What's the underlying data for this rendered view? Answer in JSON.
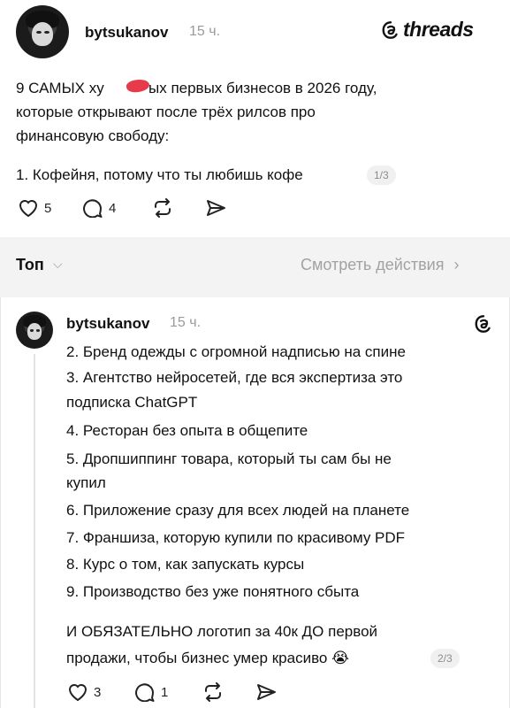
{
  "post1": {
    "username": "bytsukanov",
    "time": "15 ч.",
    "logo": "threads",
    "lines": [
      "9 САМЫХ ху",
      "ых первых бизнесов в 2026 году,",
      "которые открывают после трёх рилсов про",
      "финансовую свободу:"
    ],
    "item": "1. Кофейня, потому что ты любишь кофе",
    "page_badge": "1/3",
    "likes": "5",
    "replies": "4"
  },
  "toolbar": {
    "sort_label": "Топ",
    "view_activity": "Смотреть действия"
  },
  "post2": {
    "username": "bytsukanov",
    "time": "15 ч.",
    "lines": [
      "2. Бренд одежды с огромной надписью на спине",
      "3. Агентство нейросетей, где вся экспертиза это",
      "подписка ChatGPT",
      "4. Ресторан без опыта в общепите",
      "5. Дропшиппинг товара, который ты сам бы не",
      "купил",
      "6. Приложение сразу для всех людей на планете",
      "7. Франшиза, которую купили по красивому PDF",
      "8. Курс о том, как запускать курсы",
      "9. Производство без уже понятного сбыта"
    ],
    "closing_lines": [
      "И ОБЯЗАТЕЛЬНО логотип за 40к ДО первой",
      "продажи, чтобы бизнес умер красиво 😭"
    ],
    "page_badge": "2/3",
    "likes": "3",
    "replies": "1"
  },
  "icons": {
    "heart": "heart-icon",
    "comment": "comment-icon",
    "repost": "repost-icon",
    "share": "share-icon",
    "threads_logo": "threads-logo-icon"
  },
  "colors": {
    "redaction": "#e73a4a",
    "muted": "#9a9a9a"
  }
}
